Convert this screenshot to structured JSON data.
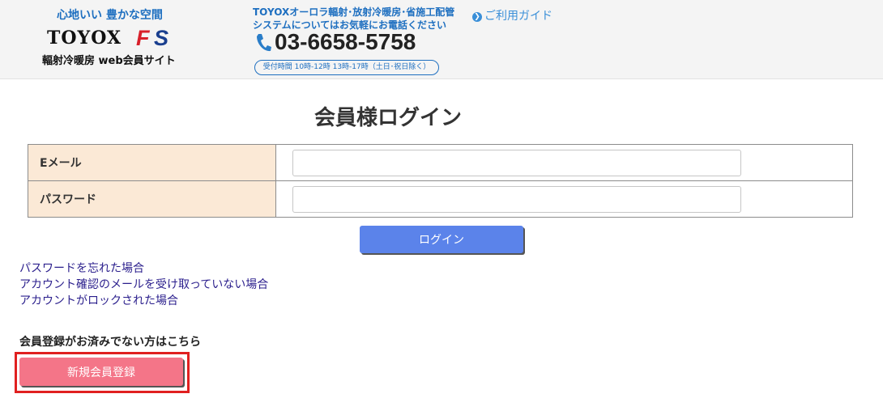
{
  "header": {
    "tagline": "心地いい 豊かな空間",
    "logo_text": "TOYOX",
    "logo_mark": "FS",
    "logo_sub": "輻射冷暖房 web会員サイト",
    "contact_line1": "TOYOXオーロラ輻射･放射冷暖房･省施工配管",
    "contact_line2": "システムについてはお気軽にお電話ください",
    "phone": "03-6658-5758",
    "hours": "受付時間 10時-12時 13時-17時（土日･祝日除く）",
    "guide_label": "ご利用ガイド"
  },
  "login": {
    "title": "会員様ログイン",
    "email_label": "Eメール",
    "email_value": "",
    "password_label": "パスワード",
    "password_value": "",
    "submit_label": "ログイン"
  },
  "links": {
    "forgot_password": "パスワードを忘れた場合",
    "no_confirmation": "アカウント確認のメールを受け取っていない場合",
    "locked": "アカウントがロックされた場合"
  },
  "register": {
    "note": "会員登録がお済みでない方はこちら",
    "button_label": "新規会員登録"
  },
  "colors": {
    "accent_blue": "#1e6fc0",
    "login_button": "#5b83ea",
    "register_button": "#f47588",
    "highlight_frame": "#e02020",
    "label_bg": "#fbe9d6"
  }
}
